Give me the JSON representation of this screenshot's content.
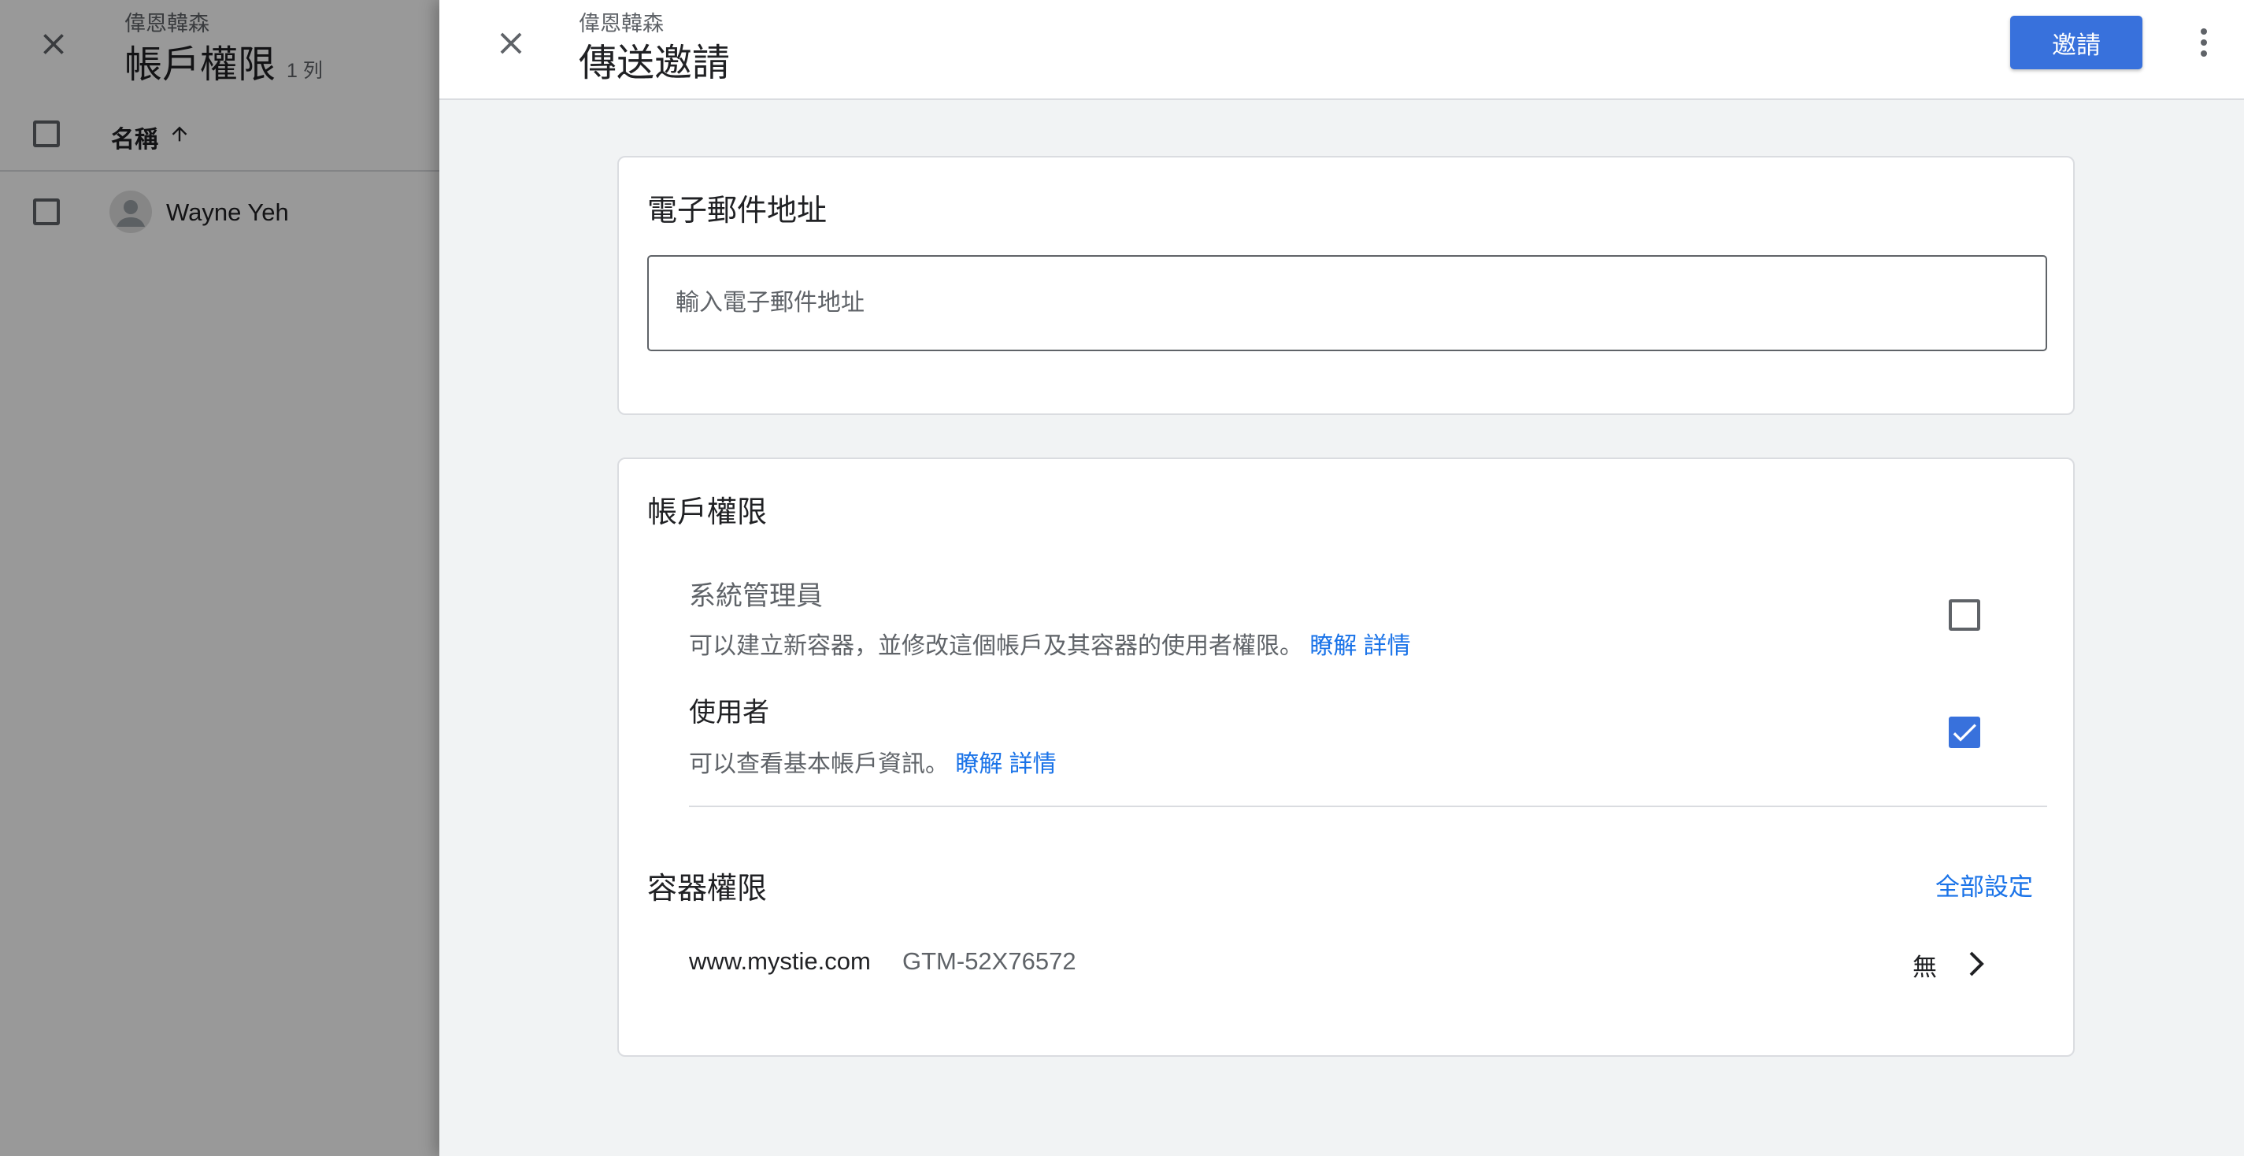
{
  "background": {
    "account_name": "偉恩韓森",
    "page_title": "帳戶權限",
    "row_count": "1 列",
    "column_name": "名稱",
    "users": [
      {
        "name": "Wayne Yeh"
      }
    ]
  },
  "panel": {
    "account_name": "偉恩韓森",
    "title": "傳送邀請",
    "invite_label": "邀請"
  },
  "email_section": {
    "title": "電子郵件地址",
    "placeholder": "輸入電子郵件地址",
    "value": ""
  },
  "account_permissions": {
    "title": "帳戶權限",
    "roles": [
      {
        "name": "系統管理員",
        "description": "可以建立新容器，並修改這個帳戶及其容器的使用者權限。",
        "link": "瞭解 詳情",
        "checked": false
      },
      {
        "name": "使用者",
        "description": "可以查看基本帳戶資訊。",
        "link": "瞭解 詳情",
        "checked": true
      }
    ]
  },
  "container_permissions": {
    "title": "容器權限",
    "set_all_label": "全部設定",
    "containers": [
      {
        "domain": "www.mystie.com",
        "id": "GTM-52X76572",
        "permission": "無"
      }
    ]
  },
  "colors": {
    "accent": "#3871dc",
    "link": "#1a73e8",
    "panel_bg": "#f1f3f4",
    "scrim": "rgba(0,0,0,0.4)"
  },
  "icons": {
    "panel_close": "close-icon",
    "background_close": "close-icon",
    "more": "more-vert-icon",
    "sort": "arrow-up-icon",
    "row_action": "chevron-right-icon",
    "avatar": "person-icon",
    "checked": "check-icon"
  }
}
